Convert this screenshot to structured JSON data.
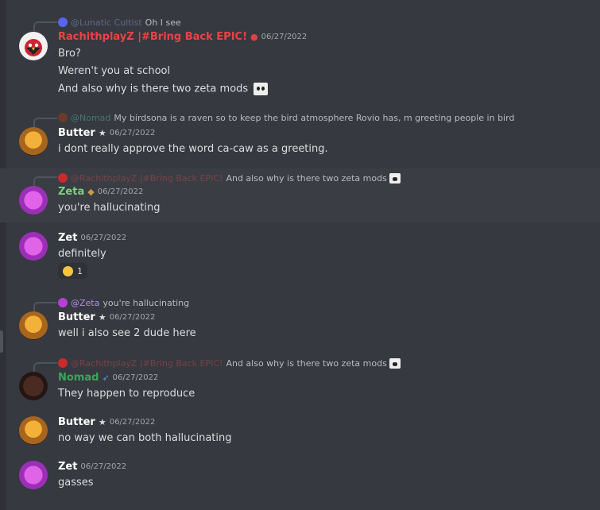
{
  "messages": [
    {
      "reply": {
        "name": "@Lunatic Cultist",
        "text": "Oh I see"
      },
      "author": "RachithplayZ |#Bring Back EPIC!",
      "timestamp": "06/27/2022",
      "lines": [
        "Bro?",
        "Weren't you at school",
        "And also why is there two zeta mods"
      ]
    },
    {
      "reply": {
        "name": "@Nomad",
        "text": "My birdsona is a raven so to keep the bird atmosphere Rovio has, m greeting people in bird"
      },
      "author": "Butter",
      "timestamp": "06/27/2022",
      "lines": [
        "i dont really approve the word ca-caw as a greeting."
      ]
    },
    {
      "reply": {
        "name": "@RachithplayZ |#Bring Back EPIC!",
        "text": "And also why is there two zeta mods"
      },
      "author": "Zeta",
      "timestamp": "06/27/2022",
      "lines": [
        "you're hallucinating"
      ]
    },
    {
      "author": "Zet",
      "timestamp": "06/27/2022",
      "lines": [
        "definitely"
      ],
      "reaction": {
        "count": "1"
      }
    },
    {
      "reply": {
        "name": "@Zeta",
        "text": "you're hallucinating"
      },
      "author": "Butter",
      "timestamp": "06/27/2022",
      "lines": [
        "well i also see 2 dude here"
      ]
    },
    {
      "reply": {
        "name": "@RachithplayZ |#Bring Back EPIC!",
        "text": "And also why is there two zeta mods"
      },
      "author": "Nomad",
      "timestamp": "06/27/2022",
      "lines": [
        "They happen to reproduce"
      ]
    },
    {
      "author": "Butter",
      "timestamp": "06/27/2022",
      "lines": [
        "no way we can both hallucinating"
      ]
    },
    {
      "author": "Zet",
      "timestamp": "06/27/2022",
      "lines": [
        "gasses"
      ]
    }
  ],
  "colors": {
    "background": "#36393f",
    "text": "#dcddde",
    "red_name": "#ed4245",
    "green_name": "#3ba55c",
    "teal_name": "#59c3a4",
    "white_name": "#ffffff"
  }
}
